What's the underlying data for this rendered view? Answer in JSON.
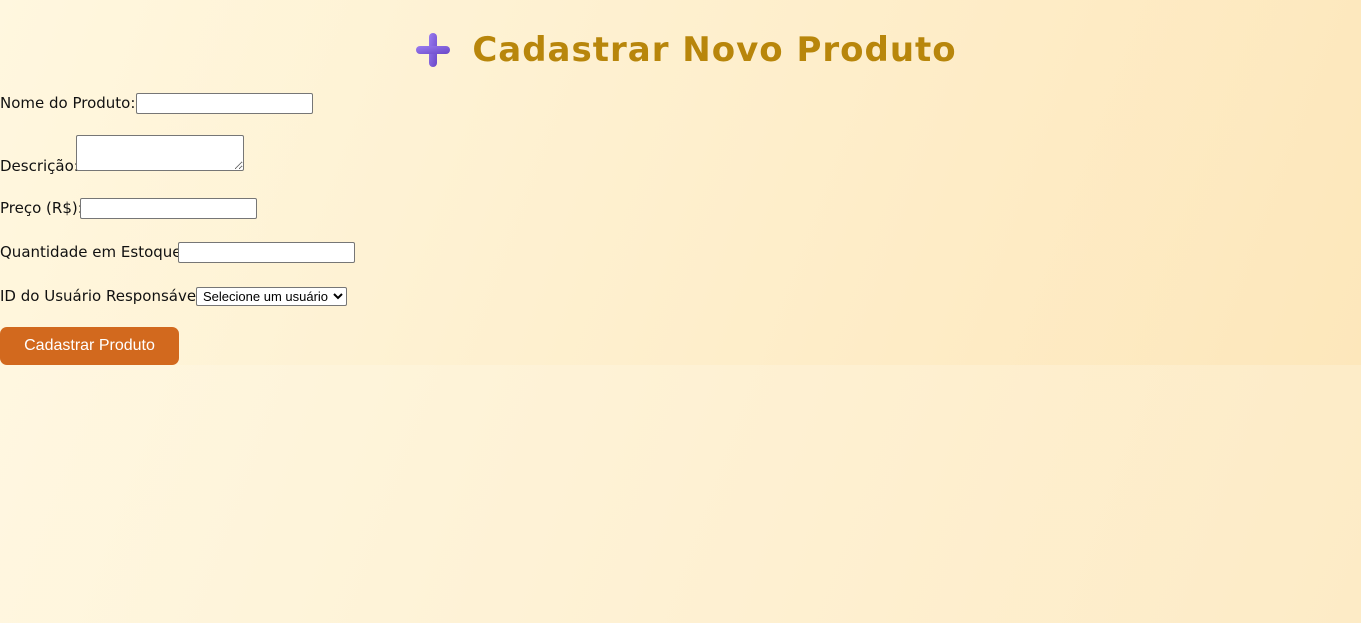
{
  "header": {
    "title": "Cadastrar Novo Produto",
    "icon": "plus-icon",
    "title_color": "#b8860b",
    "icon_color": "#7b5cd6"
  },
  "form": {
    "nome_label": "Nome do Produto:",
    "nome_value": "",
    "descricao_label": "Descrição:",
    "descricao_value": "",
    "preco_label": "Preço (R$):",
    "preco_value": "",
    "quantidade_label": "Quantidade em Estoque:",
    "quantidade_value": "",
    "usuario_label": "ID do Usuário Responsável:",
    "usuario_selected": "Selecione um usuário",
    "submit_label": "Cadastrar Produto",
    "submit_color": "#d2691e"
  }
}
